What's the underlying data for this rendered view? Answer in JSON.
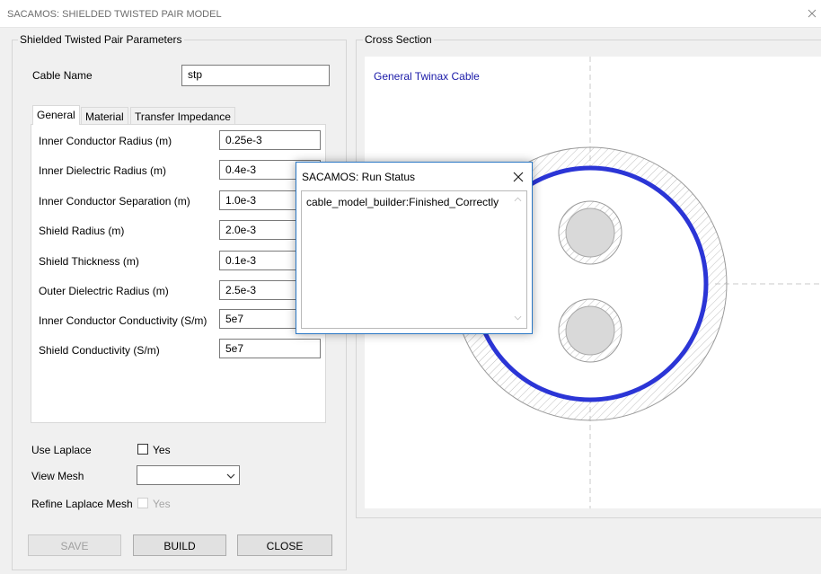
{
  "window": {
    "title": "SACAMOS: SHIELDED TWISTED PAIR MODEL"
  },
  "params": {
    "group_title": "Shielded Twisted Pair Parameters",
    "cable_name_label": "Cable Name",
    "cable_name_value": "stp",
    "tabs": [
      "General",
      "Material",
      "Transfer Impedance"
    ],
    "fields": [
      {
        "label": "Inner Conductor Radius (m)",
        "value": "0.25e-3"
      },
      {
        "label": "Inner Dielectric Radius (m)",
        "value": "0.4e-3"
      },
      {
        "label": "Inner Conductor Separation (m)",
        "value": "1.0e-3"
      },
      {
        "label": "Shield Radius (m)",
        "value": "2.0e-3"
      },
      {
        "label": "Shield Thickness (m)",
        "value": "0.1e-3"
      },
      {
        "label": "Outer Dielectric Radius (m)",
        "value": "2.5e-3"
      },
      {
        "label": "Inner Conductor Conductivity (S/m)",
        "value": "5e7"
      },
      {
        "label": "Shield Conductivity (S/m)",
        "value": "5e7"
      }
    ],
    "use_laplace_label": "Use Laplace",
    "yes_label": "Yes",
    "view_mesh_label": "View Mesh",
    "view_mesh_value": "",
    "refine_label": "Refine Laplace Mesh",
    "refine_yes_label": "Yes"
  },
  "buttons": {
    "save": "SAVE",
    "build": "BUILD",
    "close": "CLOSE"
  },
  "cross_section": {
    "group_title": "Cross Section",
    "cable_type": "General Twinax Cable",
    "shield_color": "#2b35d6"
  },
  "run_status": {
    "title": "SACAMOS: Run Status",
    "message": "cable_model_builder:Finished_Correctly"
  }
}
